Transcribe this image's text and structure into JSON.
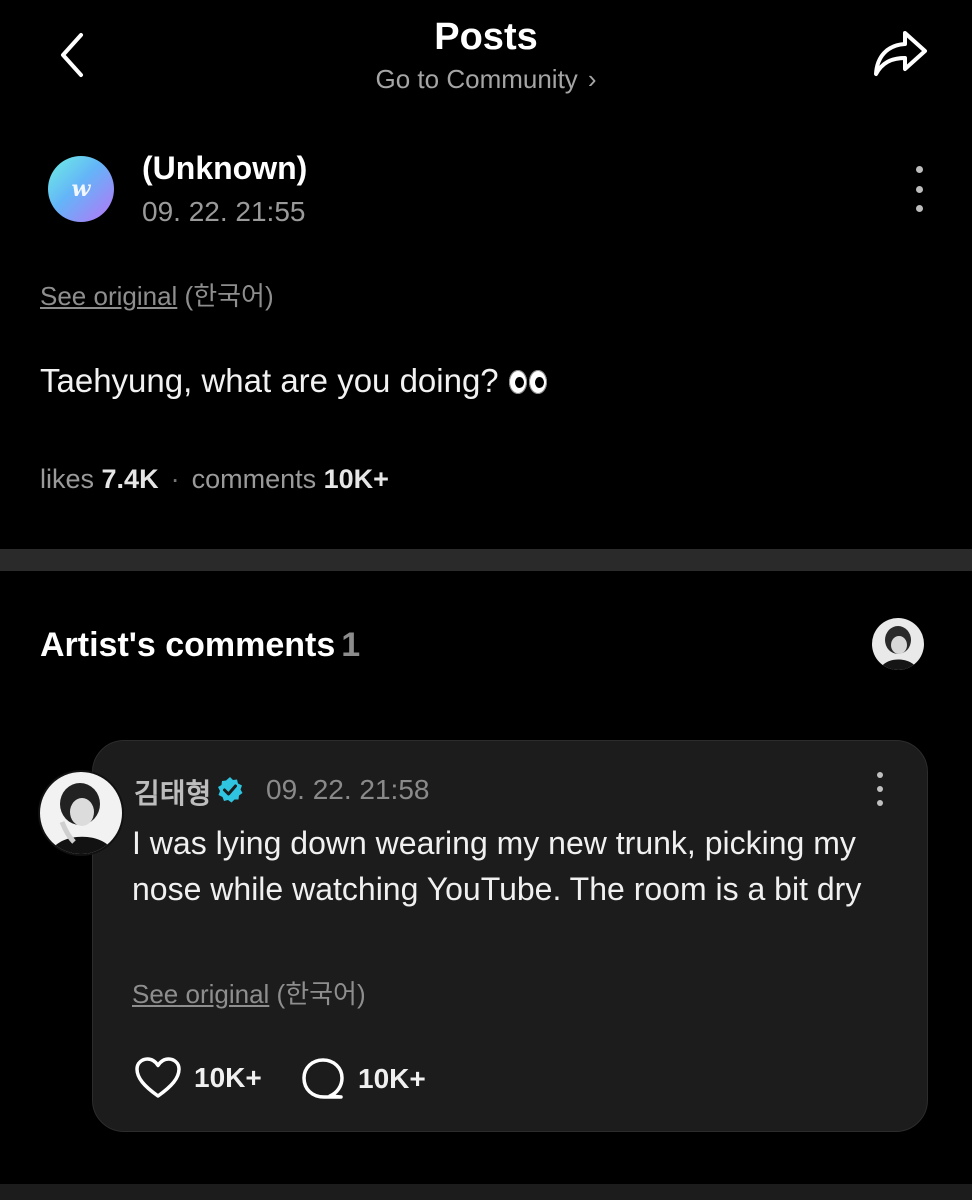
{
  "header": {
    "title": "Posts",
    "community_link": "Go to Community",
    "back_icon": "chevron-left-icon",
    "share_icon": "share-icon"
  },
  "post": {
    "author_name": "(Unknown)",
    "timestamp": "09. 22. 21:55",
    "avatar_letter": "w",
    "see_original_link": "See original",
    "see_original_lang": "(한국어)",
    "text": "Taehyung, what are you doing?",
    "emoji": "eyes-emoji",
    "stats": {
      "likes_label": "likes",
      "likes_value": "7.4K",
      "comments_label": "comments",
      "comments_value": "10K+"
    }
  },
  "artist_comments": {
    "heading": "Artist's comments",
    "count": "1",
    "comment": {
      "author": "김태형",
      "verified": true,
      "timestamp": "09. 22. 21:58",
      "text": "I was lying down wearing my new trunk, picking my nose while watching YouTube. The room is a bit dry",
      "see_original_link": "See original",
      "see_original_lang": "(한국어)",
      "likes": "10K+",
      "replies": "10K+"
    }
  },
  "colors": {
    "background": "#000000",
    "card": "#1c1c1c",
    "verified_badge": "#2fc5e0",
    "muted_text": "#9a9a9a"
  }
}
